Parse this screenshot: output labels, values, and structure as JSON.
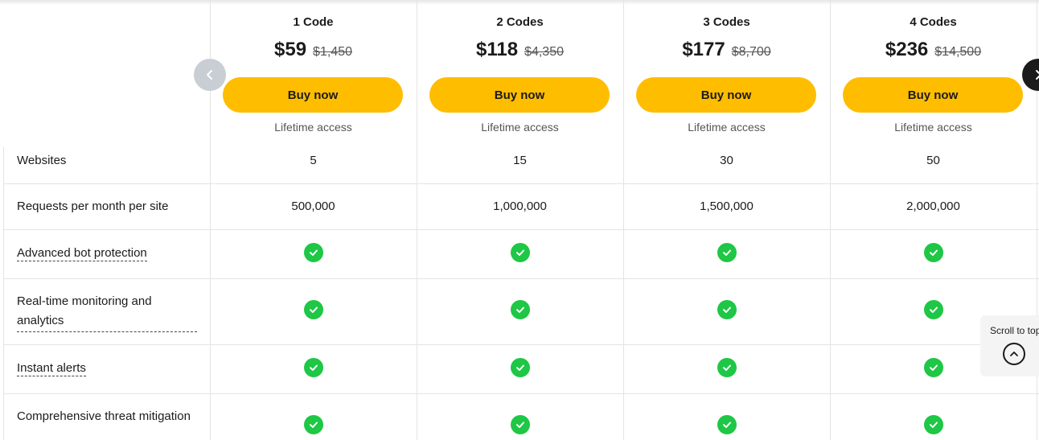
{
  "plans": [
    {
      "name": "1 Code",
      "price": "$59",
      "old_price": "$1,450",
      "button": "Buy now",
      "access": "Lifetime access"
    },
    {
      "name": "2 Codes",
      "price": "$118",
      "old_price": "$4,350",
      "button": "Buy now",
      "access": "Lifetime access"
    },
    {
      "name": "3 Codes",
      "price": "$177",
      "old_price": "$8,700",
      "button": "Buy now",
      "access": "Lifetime access"
    },
    {
      "name": "4 Codes",
      "price": "$236",
      "old_price": "$14,500",
      "button": "Buy now",
      "access": "Lifetime access"
    }
  ],
  "features": [
    {
      "label": "Websites",
      "values": [
        "5",
        "15",
        "30",
        "50"
      ]
    },
    {
      "label": "Requests per month per site",
      "values": [
        "500,000",
        "1,000,000",
        "1,500,000",
        "2,000,000"
      ]
    },
    {
      "label": "Advanced bot protection",
      "check": true
    },
    {
      "label": "Real-time monitoring and analytics",
      "check": true
    },
    {
      "label": "Instant alerts",
      "check": true
    },
    {
      "label": "Comprehensive threat mitigation",
      "check": true
    }
  ],
  "scroll_to_top": "Scroll to top",
  "colors": {
    "accent": "#ffbd00",
    "check": "#1ec745",
    "nav_prev": "#c9cdd4",
    "nav_next": "#1b1b1b"
  },
  "icons": {
    "prev": "chevron-left-icon",
    "next": "chevron-right-icon",
    "check": "check-circle-icon",
    "scroll_top": "chevron-up-icon"
  }
}
